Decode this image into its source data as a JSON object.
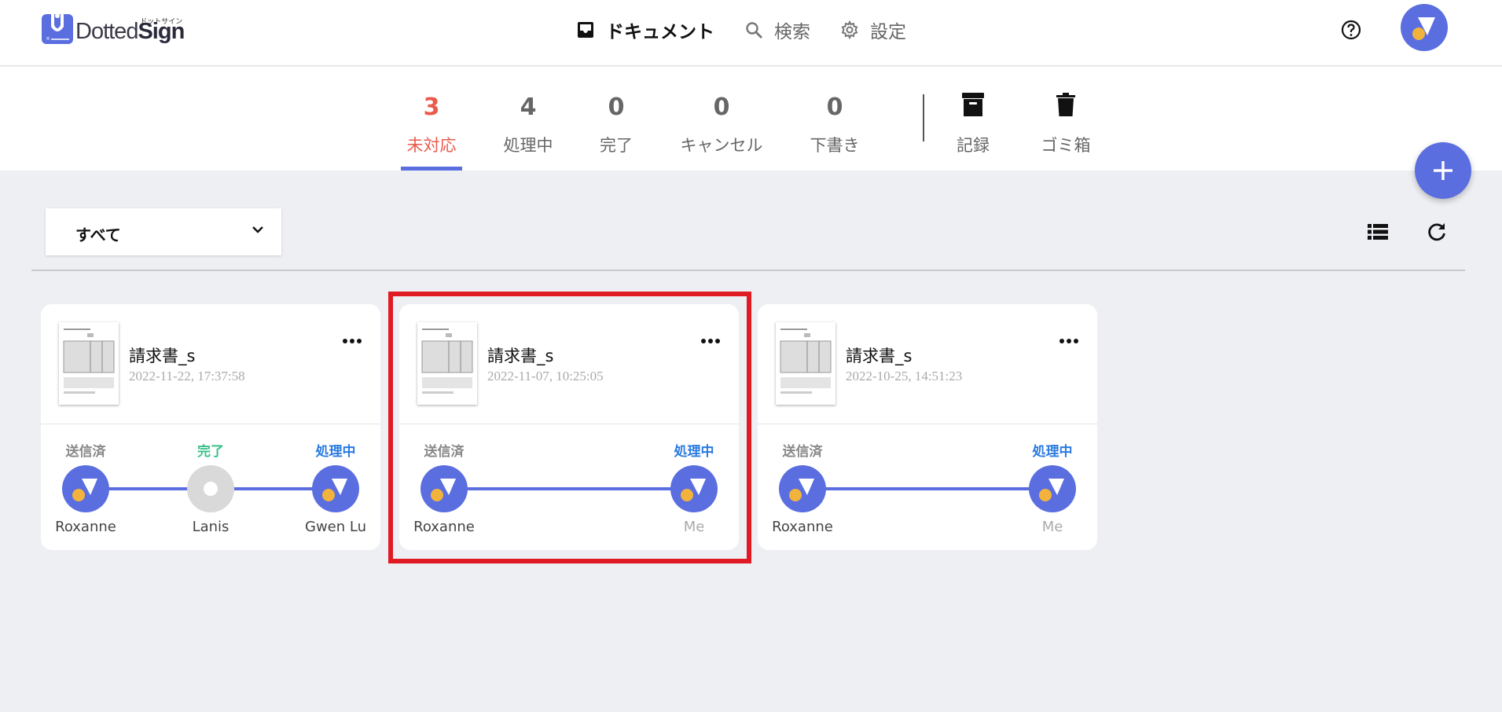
{
  "app": {
    "logo_word_light": "Dotted",
    "logo_word_bold": "Sign",
    "logo_kana": "ドットサイン"
  },
  "nav": {
    "documents": "ドキュメント",
    "search": "検索",
    "settings": "設定"
  },
  "tabs": [
    {
      "count": "3",
      "label": "未対応",
      "active": true
    },
    {
      "count": "4",
      "label": "処理中"
    },
    {
      "count": "0",
      "label": "完了"
    },
    {
      "count": "0",
      "label": "キャンセル"
    },
    {
      "count": "0",
      "label": "下書き"
    }
  ],
  "tools": {
    "records": "記録",
    "trash": "ゴミ箱"
  },
  "filter": {
    "selected": "すべて"
  },
  "cards": [
    {
      "title": "請求書_s",
      "date": "2022-11-22, 17:37:58",
      "signers": [
        {
          "status": "送信済",
          "name": "Roxanne"
        },
        {
          "status": "完了",
          "name": "Lanis"
        },
        {
          "status": "処理中",
          "name": "Gwen Lu"
        }
      ]
    },
    {
      "title": "請求書_s",
      "date": "2022-11-07, 10:25:05",
      "signers": [
        {
          "status": "送信済",
          "name": "Roxanne"
        },
        {
          "status": "処理中",
          "name": "Me"
        }
      ]
    },
    {
      "title": "請求書_s",
      "date": "2022-10-25, 14:51:23",
      "signers": [
        {
          "status": "送信済",
          "name": "Roxanne"
        },
        {
          "status": "処理中",
          "name": "Me"
        }
      ]
    }
  ],
  "colors": {
    "accent": "#5b6ee0",
    "active_tab": "#e95a4c",
    "done": "#3ac08a",
    "processing": "#2b7be0",
    "highlight": "#e01b24"
  }
}
